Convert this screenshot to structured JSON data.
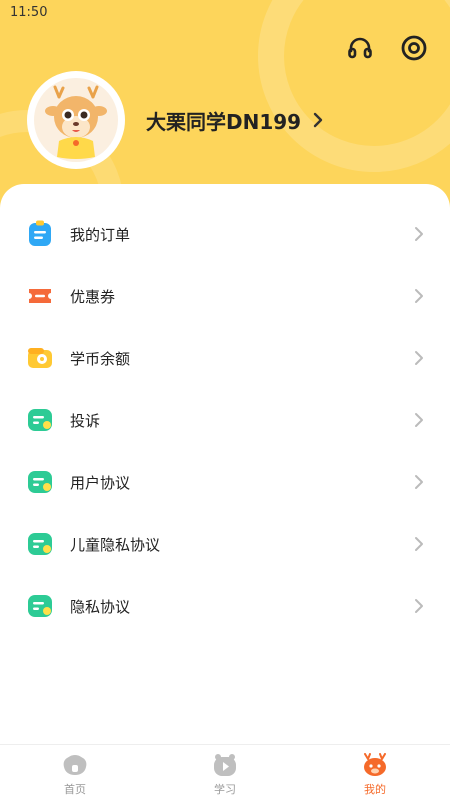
{
  "status_bar": {
    "time": "11:50"
  },
  "header": {
    "headset_icon": "headset-icon",
    "settings_icon": "settings-icon",
    "username": "大栗同学DN199"
  },
  "menu": {
    "items": [
      {
        "label": "我的订单",
        "icon": "order-icon",
        "color": "#2FA8F5"
      },
      {
        "label": "优惠券",
        "icon": "coupon-icon",
        "color": "#F56A3A"
      },
      {
        "label": "学币余额",
        "icon": "wallet-icon",
        "color": "#FFC933"
      },
      {
        "label": "投诉",
        "icon": "complaint-icon",
        "color": "#2DCB95"
      },
      {
        "label": "用户协议",
        "icon": "agreement-icon",
        "color": "#2DCB95"
      },
      {
        "label": "儿童隐私协议",
        "icon": "agreement-icon",
        "color": "#2DCB95"
      },
      {
        "label": "隐私协议",
        "icon": "agreement-icon",
        "color": "#2DCB95"
      }
    ]
  },
  "tabbar": {
    "tabs": [
      {
        "label": "首页",
        "icon": "home-icon",
        "active": false
      },
      {
        "label": "学习",
        "icon": "play-icon",
        "active": false
      },
      {
        "label": "我的",
        "icon": "deer-icon",
        "active": true
      }
    ],
    "active_color": "#F56A2A",
    "inactive_color": "#999999"
  },
  "colors": {
    "header_bg": "#FDD55B",
    "accent": "#F56A2A"
  }
}
